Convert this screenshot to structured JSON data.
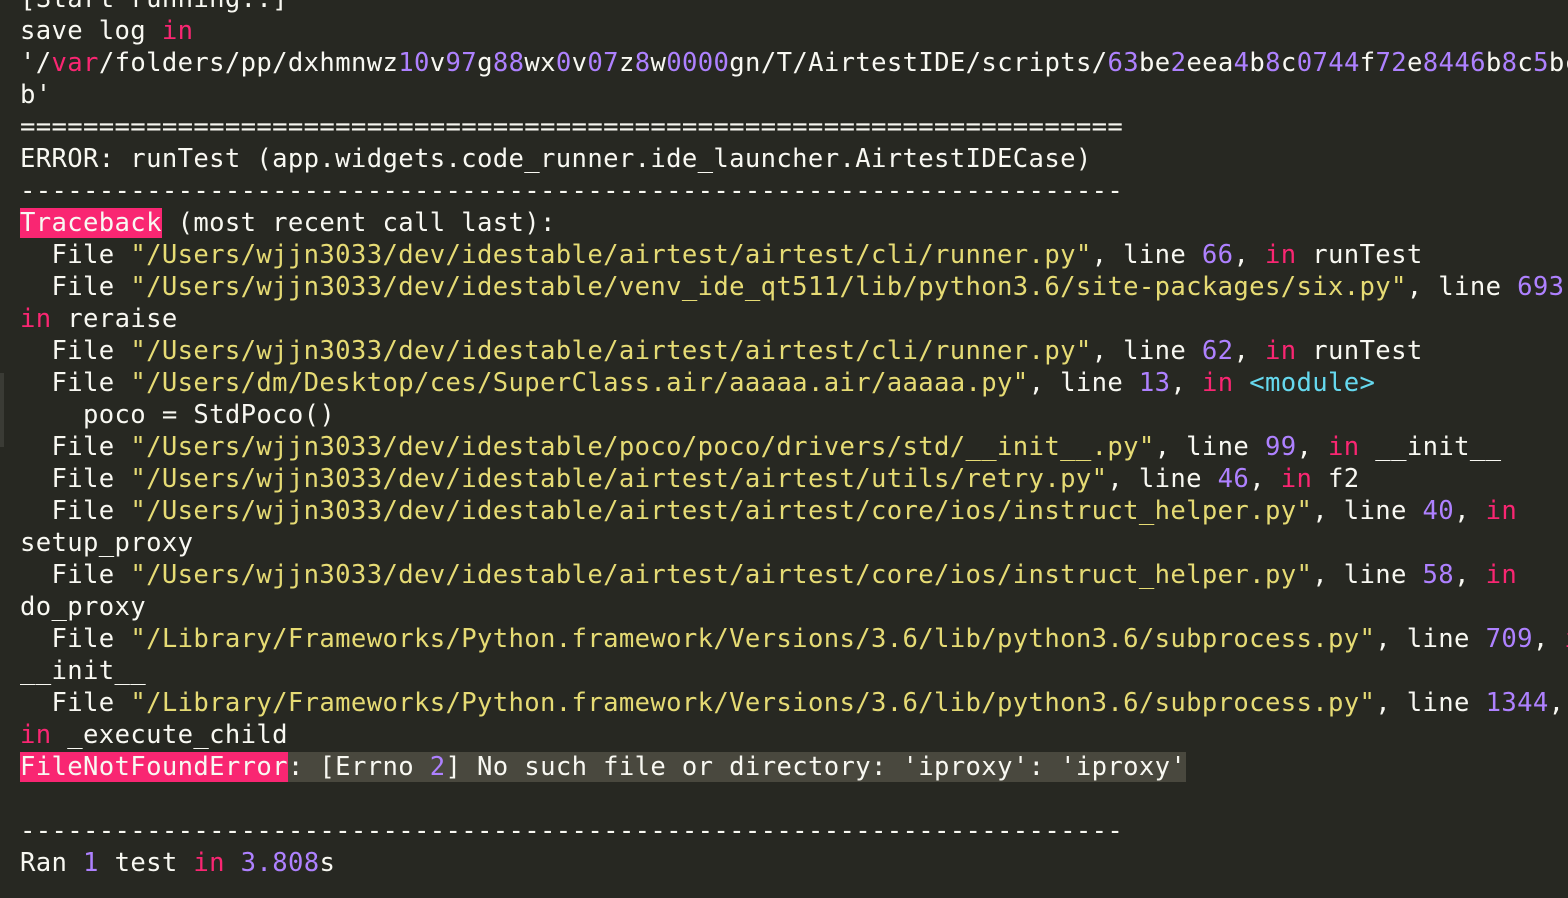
{
  "console": {
    "lines": {
      "l0": "[Start running..]",
      "l1_a": "save log ",
      "l1_b": "in",
      "l2_a": "'/",
      "l2_b": "var",
      "l2_c": "/folders/pp/dxhmnwz",
      "l2_d": "10",
      "l2_e": "v",
      "l2_f": "97",
      "l2_g": "g",
      "l2_h": "88",
      "l2_i": "wx",
      "l2_j": "0",
      "l2_k": "v",
      "l2_l": "07",
      "l2_m": "z",
      "l2_n": "8",
      "l2_o": "w",
      "l2_p": "0000",
      "l2_q": "gn/T/AirtestIDE/scripts/",
      "l2_r": "63",
      "l2_s": "be",
      "l2_t": "2",
      "l2_u": "eea",
      "l2_v": "4",
      "l2_w": "b",
      "l2_x": "8",
      "l2_y": "c",
      "l2_z": "0744",
      "l2_aa": "f",
      "l2_ab": "72",
      "l2_ac": "e",
      "l2_ad": "8446",
      "l2_ae": "b",
      "l2_af": "8",
      "l2_ag": "c",
      "l2_ah": "5",
      "l2_ai": "bcd",
      "l3": "b'",
      "l4": "======================================================================",
      "l5": "ERROR: runTest (app.widgets.code_runner.ide_launcher.AirtestIDECase)",
      "l6": "----------------------------------------------------------------------",
      "l7_a": "Traceback",
      "l7_b": " (most recent call last):",
      "file_kw": "  File ",
      "line_kw": ", line ",
      "in_kw": "in",
      "comma": ", ",
      "f1_path": "\"/Users/wjjn3033/dev/idestable/airtest/airtest/cli/runner.py\"",
      "f1_line": "66",
      "f1_fn": " runTest",
      "f2_path": "\"/Users/wjjn3033/dev/idestable/venv_ide_qt511/lib/python3.6/site-packages/six.py\"",
      "f2_line": "693",
      "f2_fn": " reraise",
      "f3_path": "\"/Users/wjjn3033/dev/idestable/airtest/airtest/cli/runner.py\"",
      "f3_line": "62",
      "f3_fn": " runTest",
      "f4_path": "\"/Users/dm/Desktop/ces/SuperClass.air/aaaaa.air/aaaaa.py\"",
      "f4_line": "13",
      "f4_fn": "<module>",
      "f4_code": "    poco = StdPoco()",
      "f5_path": "\"/Users/wjjn3033/dev/idestable/poco/poco/drivers/std/__init__.py\"",
      "f5_line": "99",
      "f5_fn": " __init__",
      "f6_path": "\"/Users/wjjn3033/dev/idestable/airtest/airtest/utils/retry.py\"",
      "f6_line": "46",
      "f6_fn": " f2",
      "f7_path": "\"/Users/wjjn3033/dev/idestable/airtest/airtest/core/ios/instruct_helper.py\"",
      "f7_line": "40",
      "f7_fn": "setup_proxy",
      "f8_path": "\"/Users/wjjn3033/dev/idestable/airtest/airtest/core/ios/instruct_helper.py\"",
      "f8_line": "58",
      "f8_fn": "do_proxy",
      "f9_path": "\"/Library/Frameworks/Python.framework/Versions/3.6/lib/python3.6/subprocess.py\"",
      "f9_line": "709",
      "f9_fn": "__init__",
      "f10_path": "\"/Library/Frameworks/Python.framework/Versions/3.6/lib/python3.6/subprocess.py\"",
      "f10_line": "1344",
      "f10_fn": " _execute_child",
      "err_name": "FileNotFoundError",
      "err_a": ": [Errno ",
      "err_num": "2",
      "err_b": "] No such file or directory: 'iproxy': 'iproxy'",
      "sep2": "----------------------------------------------------------------------",
      "ran_a": "Ran ",
      "ran_num": "1",
      "ran_b": " test ",
      "ran_in": "in",
      "ran_time": "3.808",
      "ran_s": "s"
    },
    "colors": {
      "background": "#272822",
      "text": "#f8f8f2",
      "keyword": "#f92672",
      "number": "#ae81ff",
      "string": "#e6db74",
      "tag": "#66d9ef"
    }
  }
}
